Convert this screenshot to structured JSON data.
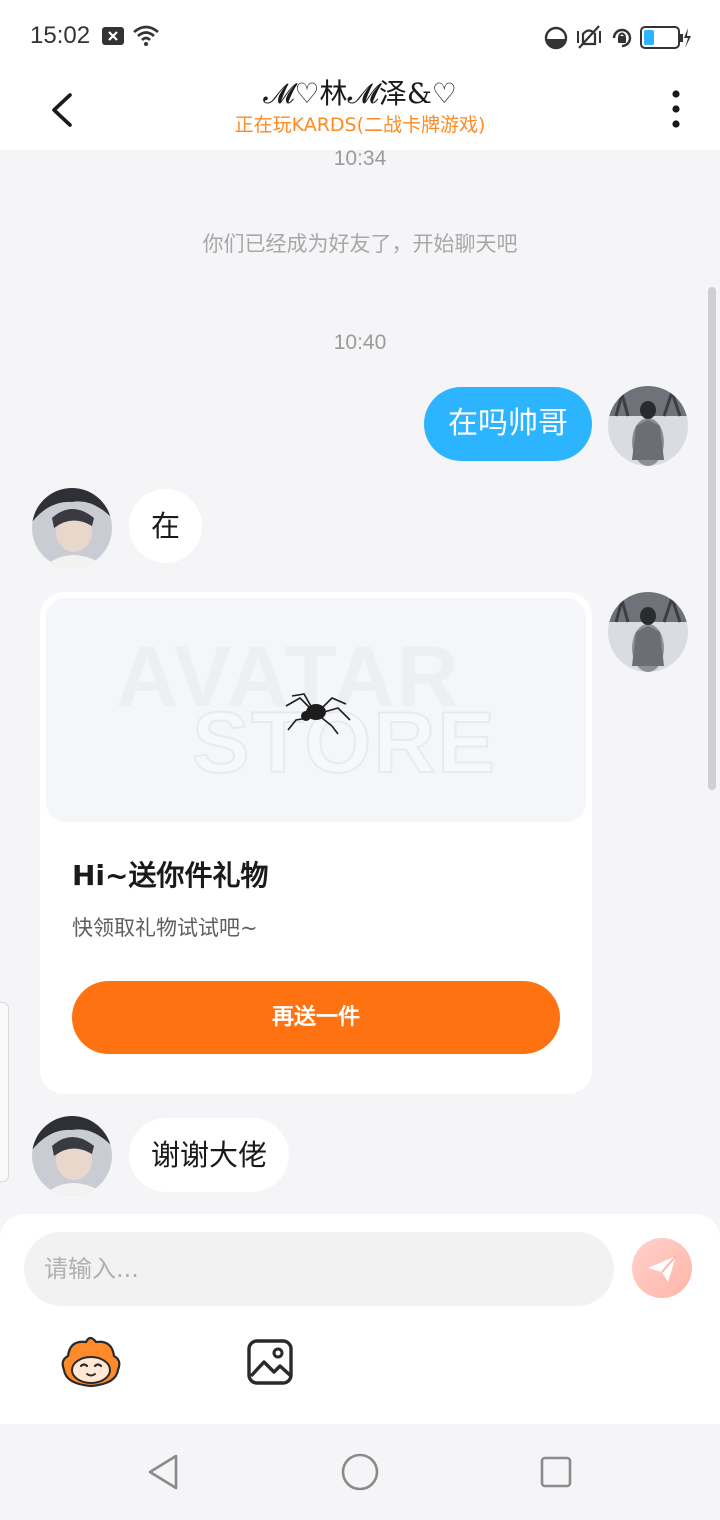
{
  "status_bar": {
    "time": "15:02",
    "icons": [
      "close-notification-icon",
      "wifi-icon",
      "data-saver-icon",
      "vibrate-icon",
      "rotation-lock-icon",
      "battery-charging-icon"
    ],
    "battery_color": "#2db4ff"
  },
  "header": {
    "title": "𝓜♡林𝓜泽&♡",
    "subtitle": "正在玩KARDS(二战卡牌游戏)",
    "subtitle_color": "#ff8a1f"
  },
  "chat": {
    "time_1": "10:34",
    "system_message": "你们已经成为好友了，开始聊天吧",
    "time_2": "10:40",
    "messages": [
      {
        "side": "right",
        "text": "在吗帅哥"
      },
      {
        "side": "left",
        "text": "在"
      },
      {
        "side": "left",
        "text": "谢谢大佬"
      }
    ],
    "gift_card": {
      "watermark_top": "AVATAR",
      "watermark_bottom": "STORE",
      "title": "Hi~送你件礼物",
      "subtitle": "快领取礼物试试吧~",
      "button_label": "再送一件"
    },
    "bubble_color_self": "#2db4ff",
    "accent_color": "#ff7212"
  },
  "input_bar": {
    "placeholder": "请输入...",
    "tools": [
      "emoji-mascot-icon",
      "image-icon"
    ]
  },
  "nav_bar": {
    "buttons": [
      "back-triangle-icon",
      "home-circle-icon",
      "recents-square-icon"
    ]
  }
}
